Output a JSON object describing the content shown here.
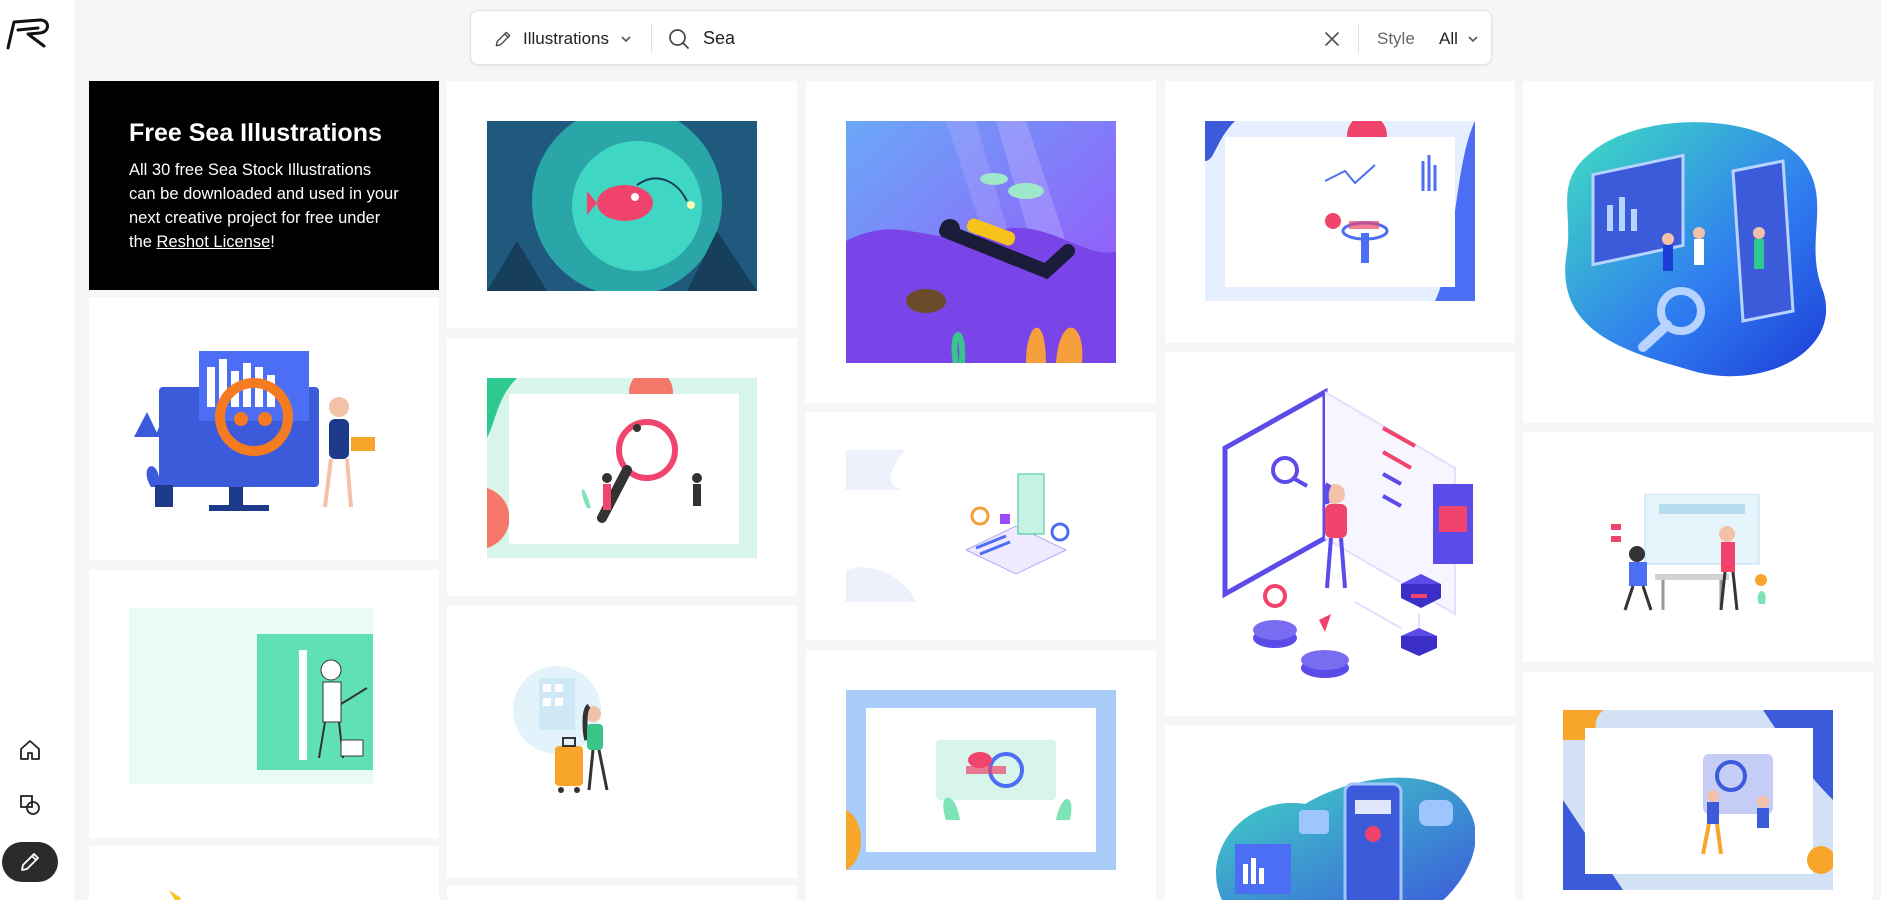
{
  "search": {
    "type_label": "Illustrations",
    "query": "Sea",
    "style_label": "Style",
    "style_value": "All"
  },
  "promo": {
    "title": "Free Sea Illustrations",
    "text_before": "All 30 free Sea Stock Illustrations can be downloaded and used in your next creative project for free under the ",
    "license_link": "Reshot License",
    "text_after": "!"
  },
  "nav": {
    "icons": [
      "home-icon",
      "shapes-icon",
      "pencil-icon"
    ]
  },
  "colors": {
    "accent_dark": "#2b2b2b",
    "blue": "#3b5bdb",
    "teal": "#3fd6c4",
    "pink": "#f0446d"
  }
}
